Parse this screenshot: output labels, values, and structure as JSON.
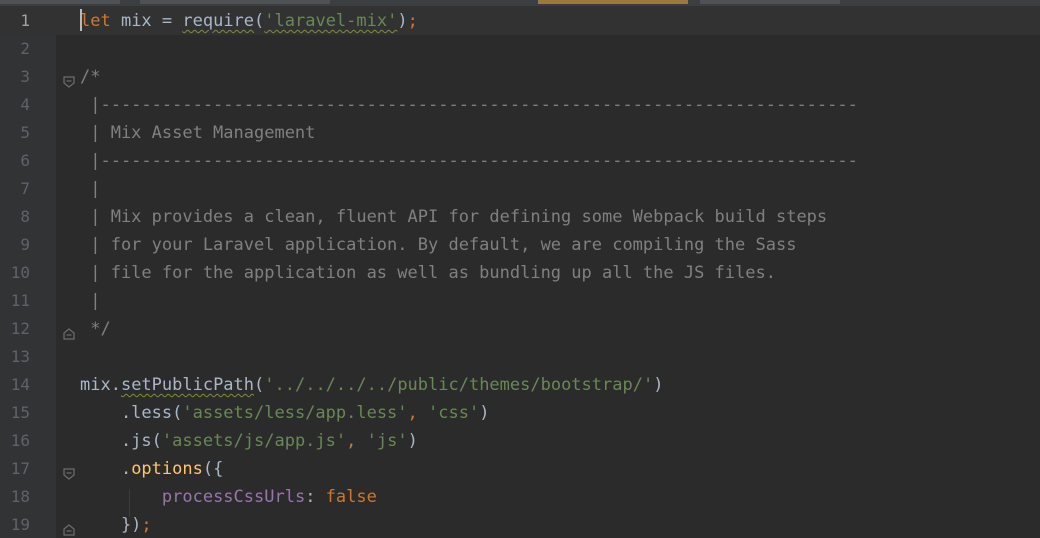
{
  "editor": {
    "language": "javascript",
    "colors": {
      "background": "#2b2b2b",
      "gutter": "#313335",
      "current_line": "#323232",
      "keyword": "#cc7832",
      "string": "#6a8759",
      "comment": "#808080",
      "property": "#9876aa",
      "function": "#ffc66d",
      "text": "#a9b7c6",
      "line_number": "#606366"
    },
    "current_line": 1,
    "lines": [
      {
        "number": "1",
        "fold_icon": "",
        "tokens": [
          {
            "text": "let",
            "kind": "kw"
          },
          {
            "text": " mix = ",
            "kind": "txt"
          },
          {
            "text": "require",
            "kind": "txt",
            "warn": true
          },
          {
            "text": "(",
            "kind": "txt"
          },
          {
            "text": "'laravel-mix'",
            "kind": "str",
            "warn": true
          },
          {
            "text": ")",
            "kind": "txt"
          },
          {
            "text": ";",
            "kind": "kw"
          }
        ]
      },
      {
        "number": "2",
        "fold_icon": "",
        "tokens": []
      },
      {
        "number": "3",
        "fold_icon": "fold-open-icon",
        "tokens": [
          {
            "text": "/*",
            "kind": "cm"
          }
        ]
      },
      {
        "number": "4",
        "fold_icon": "",
        "tokens": [
          {
            "text": " |--------------------------------------------------------------------------",
            "kind": "cm"
          }
        ]
      },
      {
        "number": "5",
        "fold_icon": "",
        "tokens": [
          {
            "text": " | Mix Asset Management",
            "kind": "cm"
          }
        ]
      },
      {
        "number": "6",
        "fold_icon": "",
        "tokens": [
          {
            "text": " |--------------------------------------------------------------------------",
            "kind": "cm"
          }
        ]
      },
      {
        "number": "7",
        "fold_icon": "",
        "tokens": [
          {
            "text": " |",
            "kind": "cm"
          }
        ]
      },
      {
        "number": "8",
        "fold_icon": "",
        "tokens": [
          {
            "text": " | Mix provides a clean, fluent API for defining some Webpack build steps",
            "kind": "cm"
          }
        ]
      },
      {
        "number": "9",
        "fold_icon": "",
        "tokens": [
          {
            "text": " | for your Laravel application. By default, we are compiling the Sass",
            "kind": "cm"
          }
        ]
      },
      {
        "number": "10",
        "fold_icon": "",
        "tokens": [
          {
            "text": " | file for the application as well as bundling up all the JS files.",
            "kind": "cm"
          }
        ]
      },
      {
        "number": "11",
        "fold_icon": "",
        "tokens": [
          {
            "text": " |",
            "kind": "cm"
          }
        ]
      },
      {
        "number": "12",
        "fold_icon": "fold-close-icon",
        "tokens": [
          {
            "text": " */",
            "kind": "cm"
          }
        ]
      },
      {
        "number": "13",
        "fold_icon": "",
        "tokens": []
      },
      {
        "number": "14",
        "fold_icon": "",
        "tokens": [
          {
            "text": "mix.",
            "kind": "txt"
          },
          {
            "text": "setPublicPath",
            "kind": "txt",
            "warn": true
          },
          {
            "text": "(",
            "kind": "txt"
          },
          {
            "text": "'../../../../public/themes/bootstrap/'",
            "kind": "str"
          },
          {
            "text": ")",
            "kind": "txt"
          }
        ]
      },
      {
        "number": "15",
        "fold_icon": "",
        "tokens": [
          {
            "text": "    .less(",
            "kind": "txt"
          },
          {
            "text": "'assets/less/app.less'",
            "kind": "str"
          },
          {
            "text": ", ",
            "kind": "kw"
          },
          {
            "text": "'css'",
            "kind": "str"
          },
          {
            "text": ")",
            "kind": "txt"
          }
        ]
      },
      {
        "number": "16",
        "fold_icon": "",
        "tokens": [
          {
            "text": "    .js(",
            "kind": "txt"
          },
          {
            "text": "'assets/js/app.js'",
            "kind": "str"
          },
          {
            "text": ", ",
            "kind": "kw"
          },
          {
            "text": "'js'",
            "kind": "str"
          },
          {
            "text": ")",
            "kind": "txt"
          }
        ]
      },
      {
        "number": "17",
        "fold_icon": "fold-open-icon",
        "tokens": [
          {
            "text": "    .",
            "kind": "txt"
          },
          {
            "text": "options",
            "kind": "fn"
          },
          {
            "text": "({",
            "kind": "txt"
          }
        ]
      },
      {
        "number": "18",
        "fold_icon": "",
        "tokens": [
          {
            "text": "        ",
            "kind": "txt"
          },
          {
            "text": "processCssUrls",
            "kind": "prop"
          },
          {
            "text": ": ",
            "kind": "txt"
          },
          {
            "text": "false",
            "kind": "kw"
          }
        ]
      },
      {
        "number": "19",
        "fold_icon": "fold-close-icon",
        "tokens": [
          {
            "text": "    })",
            "kind": "txt"
          },
          {
            "text": ";",
            "kind": "kw"
          }
        ]
      }
    ]
  }
}
